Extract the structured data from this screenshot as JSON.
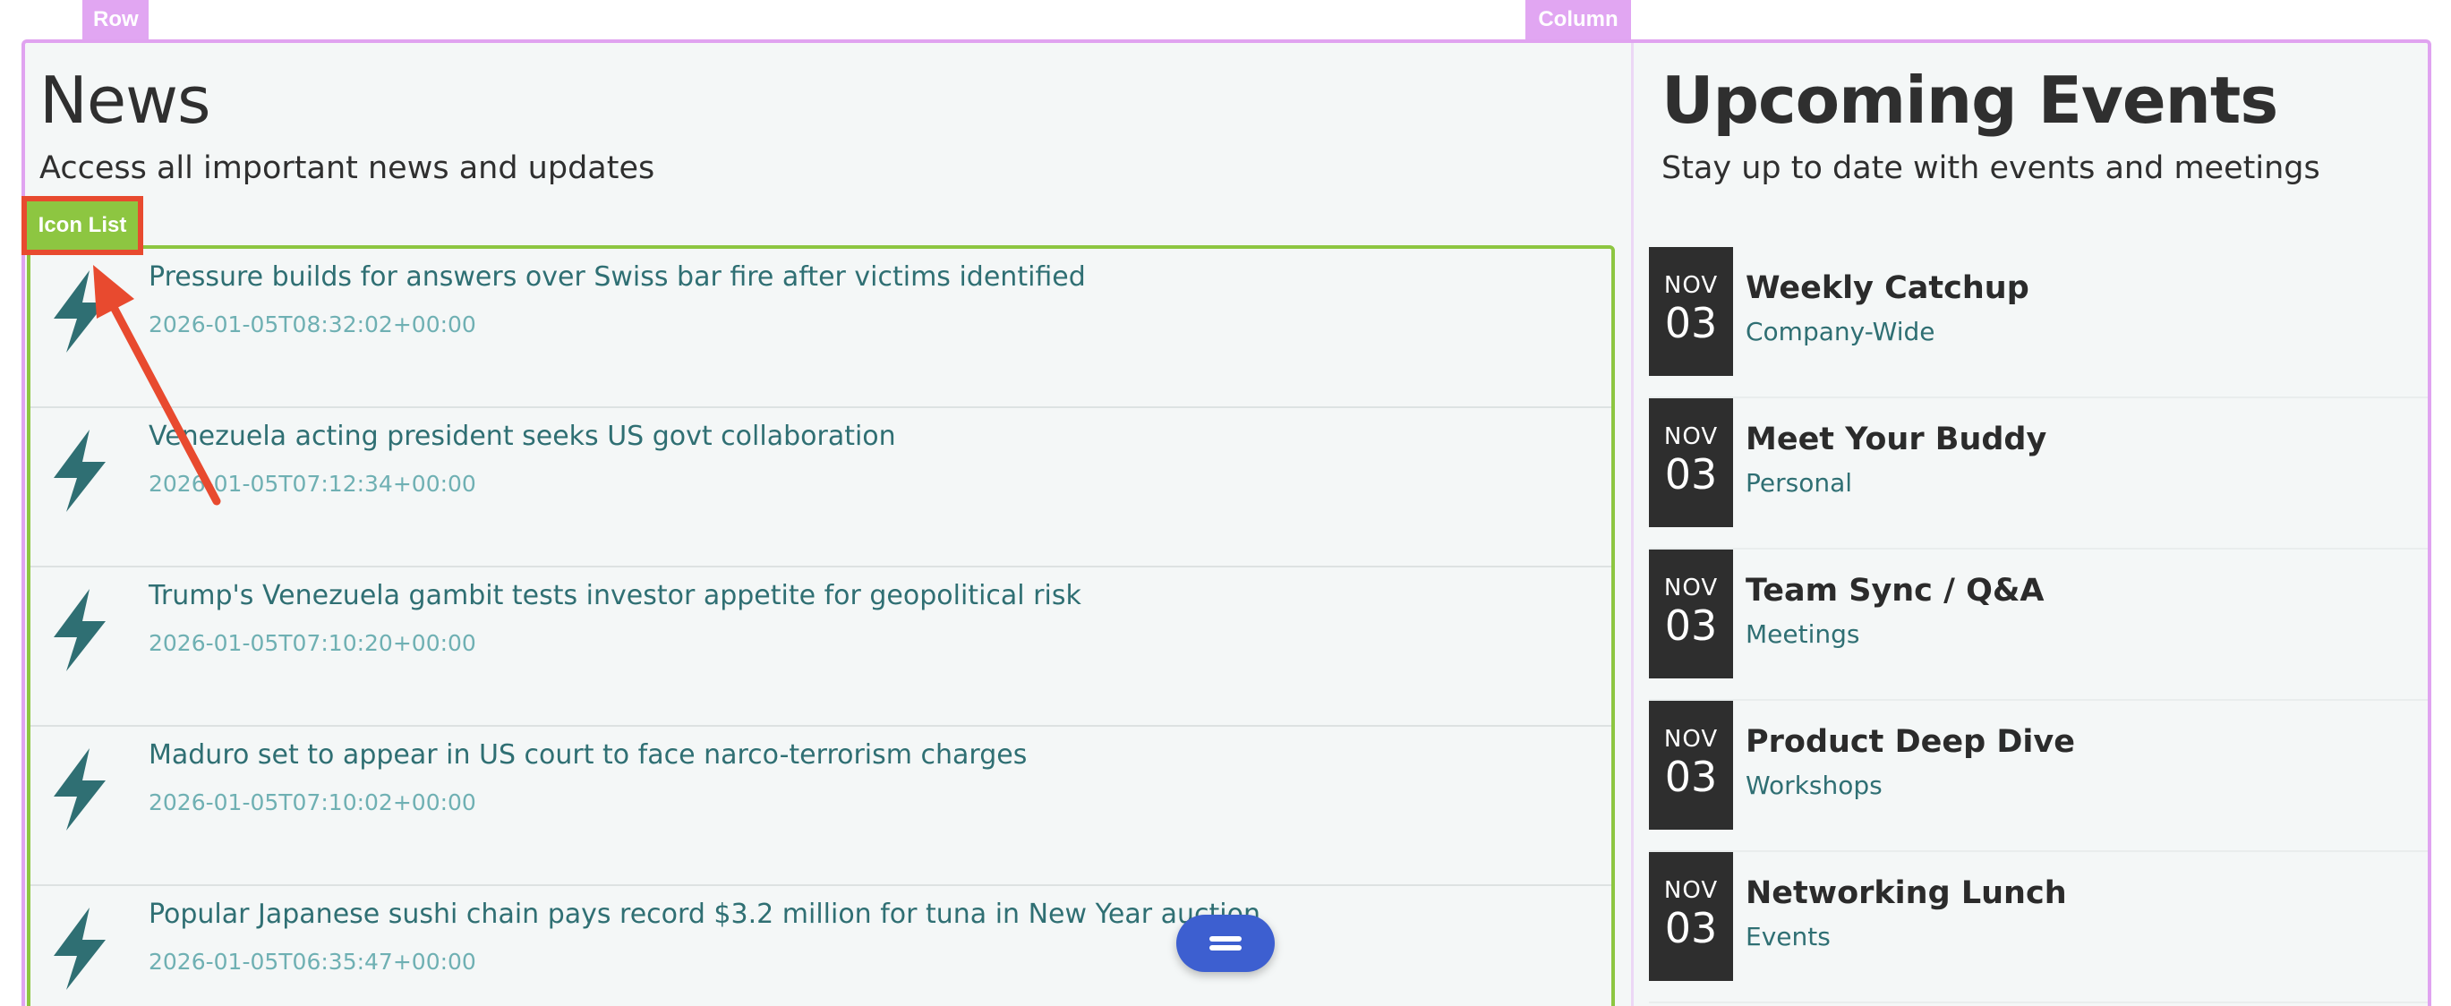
{
  "overlay": {
    "row_tag": "Row",
    "column_tag": "Column",
    "icon_list_tag": "Icon List"
  },
  "news": {
    "title": "News",
    "subtitle": "Access all important news and updates",
    "items": [
      {
        "headline": "Pressure builds for answers over Swiss bar fire after victims identified",
        "timestamp": "2026-01-05T08:32:02+00:00",
        "icon": "lightning-bolt-icon"
      },
      {
        "headline": "Venezuela acting president seeks US govt collaboration",
        "timestamp": "2026-01-05T07:12:34+00:00",
        "icon": "lightning-bolt-icon"
      },
      {
        "headline": "Trump's Venezuela gambit tests investor appetite for geopolitical risk",
        "timestamp": "2026-01-05T07:10:20+00:00",
        "icon": "lightning-bolt-icon"
      },
      {
        "headline": "Maduro set to appear in US court to face narco-terrorism charges",
        "timestamp": "2026-01-05T07:10:02+00:00",
        "icon": "lightning-bolt-icon"
      },
      {
        "headline": "Popular Japanese sushi chain pays record $3.2 million for tuna in New Year auction",
        "timestamp": "2026-01-05T06:35:47+00:00",
        "icon": "lightning-bolt-icon"
      }
    ]
  },
  "events": {
    "title": "Upcoming Events",
    "subtitle": "Stay up to date with events and meetings",
    "items": [
      {
        "month": "NOV",
        "day": "03",
        "name": "Weekly Catchup",
        "category": "Company-Wide"
      },
      {
        "month": "NOV",
        "day": "03",
        "name": "Meet Your Buddy",
        "category": "Personal"
      },
      {
        "month": "NOV",
        "day": "03",
        "name": "Team Sync / Q&A",
        "category": "Meetings"
      },
      {
        "month": "NOV",
        "day": "03",
        "name": "Product Deep Dive",
        "category": "Workshops"
      },
      {
        "month": "NOV",
        "day": "03",
        "name": "Networking Lunch",
        "category": "Events"
      }
    ]
  },
  "colors": {
    "accent_teal": "#2f6f73",
    "timestamp_teal": "#6fb0b3",
    "row_outline": "#e0a3f0",
    "icon_list_green": "#8dc641",
    "annotation_red": "#e84a2f",
    "fab_blue": "#3d5fd0"
  }
}
